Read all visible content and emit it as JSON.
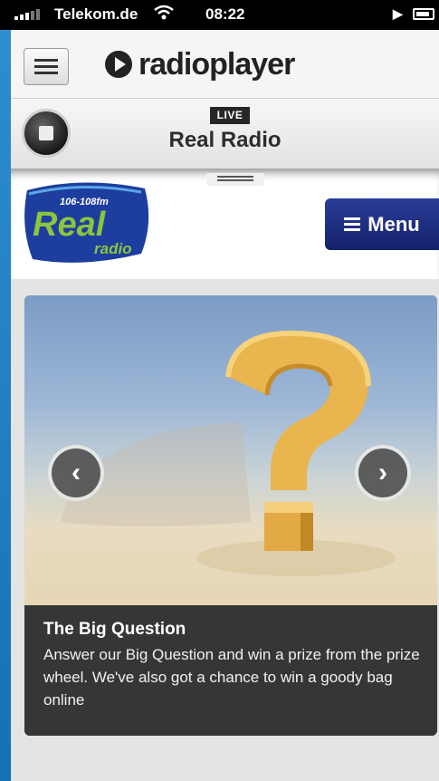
{
  "status_bar": {
    "carrier": "Telekom.de",
    "time": "08:22",
    "signal_icon": "signal-bars-icon",
    "wifi_icon": "wifi-icon",
    "play_icon": "play-icon",
    "battery_icon": "battery-icon"
  },
  "header": {
    "menu_icon": "hamburger-icon",
    "logo_text": "radioplayer"
  },
  "now_playing": {
    "badge": "LIVE",
    "station_name": "Real Radio",
    "control_icon": "stop-icon"
  },
  "station": {
    "logo_frequency": "106-108fm",
    "logo_name": "Real",
    "logo_sub": "radio",
    "menu_button_label": "Menu"
  },
  "carousel": {
    "prev_icon": "chevron-left-icon",
    "next_icon": "chevron-right-icon",
    "slide": {
      "title": "The Big Question",
      "description": "Answer our Big Question and win a prize from the prize wheel. We've also got a chance to win a goody bag online"
    }
  },
  "colors": {
    "page_frame": "#1b7fc2",
    "menu_button": "#1f2f85",
    "logo_blue": "#1d3e9e",
    "logo_green": "#8bc53f",
    "caption_bg": "#363636"
  }
}
